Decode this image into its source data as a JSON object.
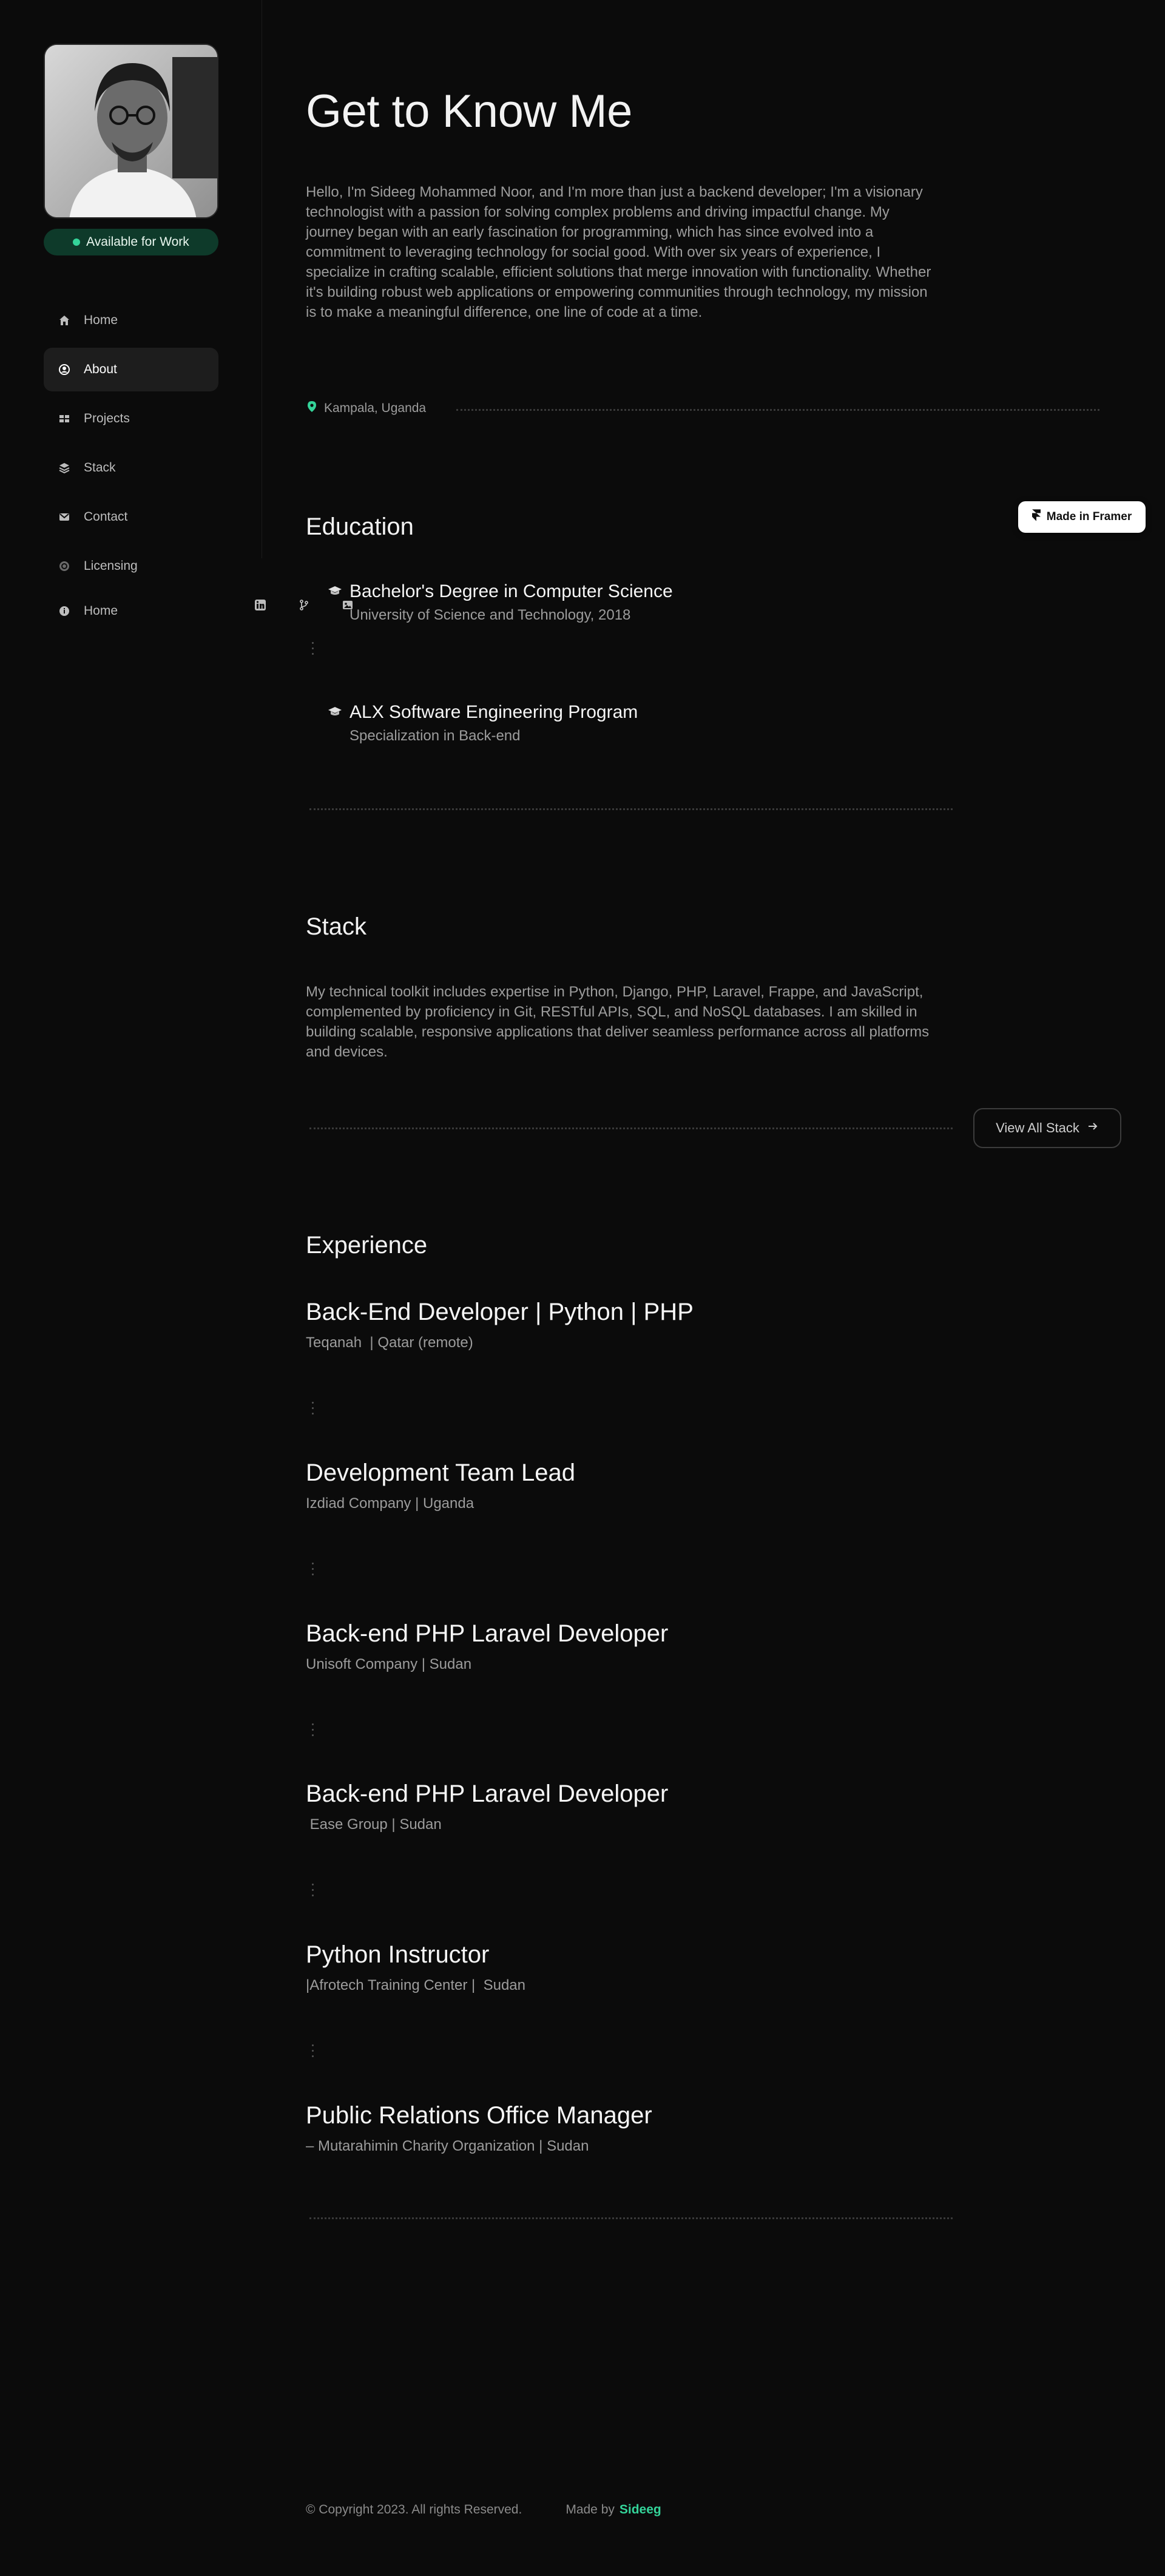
{
  "sidebar": {
    "status": "Available for Work",
    "nav": [
      {
        "label": "Home",
        "icon": "home-icon"
      },
      {
        "label": "About",
        "icon": "user-circle-icon"
      },
      {
        "label": "Projects",
        "icon": "grid-icon"
      },
      {
        "label": "Stack",
        "icon": "layers-icon"
      },
      {
        "label": "Contact",
        "icon": "mail-icon"
      },
      {
        "label": "Licensing",
        "icon": "copyright-icon"
      }
    ],
    "footer_label": "Home",
    "footer_icon": "info-icon",
    "social_icons": [
      "linkedin-icon",
      "github-icon",
      "image-icon"
    ]
  },
  "main": {
    "title": "Get to Know Me",
    "bio": "Hello, I'm Sideeg Mohammed Noor, and I'm more than just a backend developer; I'm a visionary technologist with a passion for solving complex problems and driving impactful change. My journey began with an early fascination for programming, which has since evolved into a commitment to leveraging technology for social good. With over six years of experience, I specialize in crafting scalable, efficient solutions that merge innovation with functionality. Whether it's building robust web applications or empowering communities through technology, my mission is to make a meaningful difference, one line of code at a time.",
    "location": "Kampala, Uganda"
  },
  "education": {
    "title": "Education",
    "items": [
      {
        "title": "Bachelor's Degree in Computer Science",
        "sub": "University of Science and Technology, 2018"
      },
      {
        "title": "ALX Software Engineering Program",
        "sub": "Specialization in Back-end"
      }
    ]
  },
  "stack": {
    "title": "Stack",
    "text": "My technical toolkit includes expertise in Python, Django, PHP, Laravel, Frappe, and JavaScript, complemented by proficiency in Git, RESTful APIs, SQL, and NoSQL databases. I am skilled in building scalable, responsive applications that deliver seamless performance across all platforms and devices.",
    "button": "View All Stack"
  },
  "experience": {
    "title": "Experience",
    "items": [
      {
        "title": "Back-End Developer | Python | PHP",
        "sub": "Teqanah  | Qatar (remote)"
      },
      {
        "title": "Development Team Lead",
        "sub": "Izdiad Company | Uganda"
      },
      {
        "title": "Back-end PHP Laravel Developer",
        "sub": "Unisoft Company | Sudan"
      },
      {
        "title": "Back-end PHP Laravel Developer",
        "sub": " Ease Group | Sudan"
      },
      {
        "title": "Python Instructor",
        "sub": "|Afrotech Training Center |  Sudan"
      },
      {
        "title": "Public Relations Office Manager",
        "sub": "– Mutarahimin Charity Organization | Sudan"
      }
    ]
  },
  "footer": {
    "copyright": "© Copyright 2023. All rights Reserved.",
    "made_by": "Made by",
    "author": "Sideeg"
  },
  "framer_badge": "Made in Framer",
  "colors": {
    "background": "#0b0b0b",
    "accent": "#34d399",
    "status_bg": "#0e3a2a"
  }
}
